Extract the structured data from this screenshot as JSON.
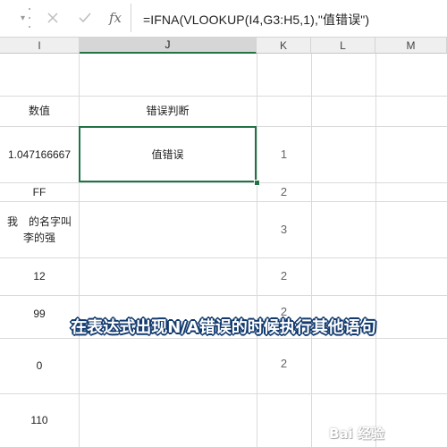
{
  "formula_bar": {
    "name_box_tail": "▾",
    "cancel_icon": "x-icon",
    "enter_icon": "check-icon",
    "fx_label": "fx",
    "formula": "=IFNA(VLOOKUP(I4,G3:H5,1),\"值错误\")"
  },
  "columns": [
    {
      "label": "I",
      "selected": false
    },
    {
      "label": "J",
      "selected": true
    },
    {
      "label": "K",
      "selected": false
    },
    {
      "label": "L",
      "selected": false
    },
    {
      "label": "M",
      "selected": false
    }
  ],
  "rows": [
    {
      "i": "",
      "j": "",
      "k": ""
    },
    {
      "i": "数值",
      "j": "错误判断",
      "k": ""
    },
    {
      "i": "1.047166667",
      "j": "值错误",
      "k": "1"
    },
    {
      "i": "FF",
      "j": "",
      "k": "2"
    },
    {
      "i_lines": [
        "我　的名字叫",
        "李的强"
      ],
      "j": "",
      "k": "3"
    },
    {
      "i": "12",
      "j": "",
      "k": "2"
    },
    {
      "i": "99",
      "j": "",
      "k": "2"
    },
    {
      "i": "0",
      "j": "",
      "k": "2"
    },
    {
      "i": "110",
      "j": "",
      "k": ""
    }
  ],
  "caption": "在表达式出现N/A错误的时候执行其他语句",
  "watermark": "Bai 经验",
  "colors": {
    "accent": "#217346",
    "caption_outline": "#123a6e"
  }
}
